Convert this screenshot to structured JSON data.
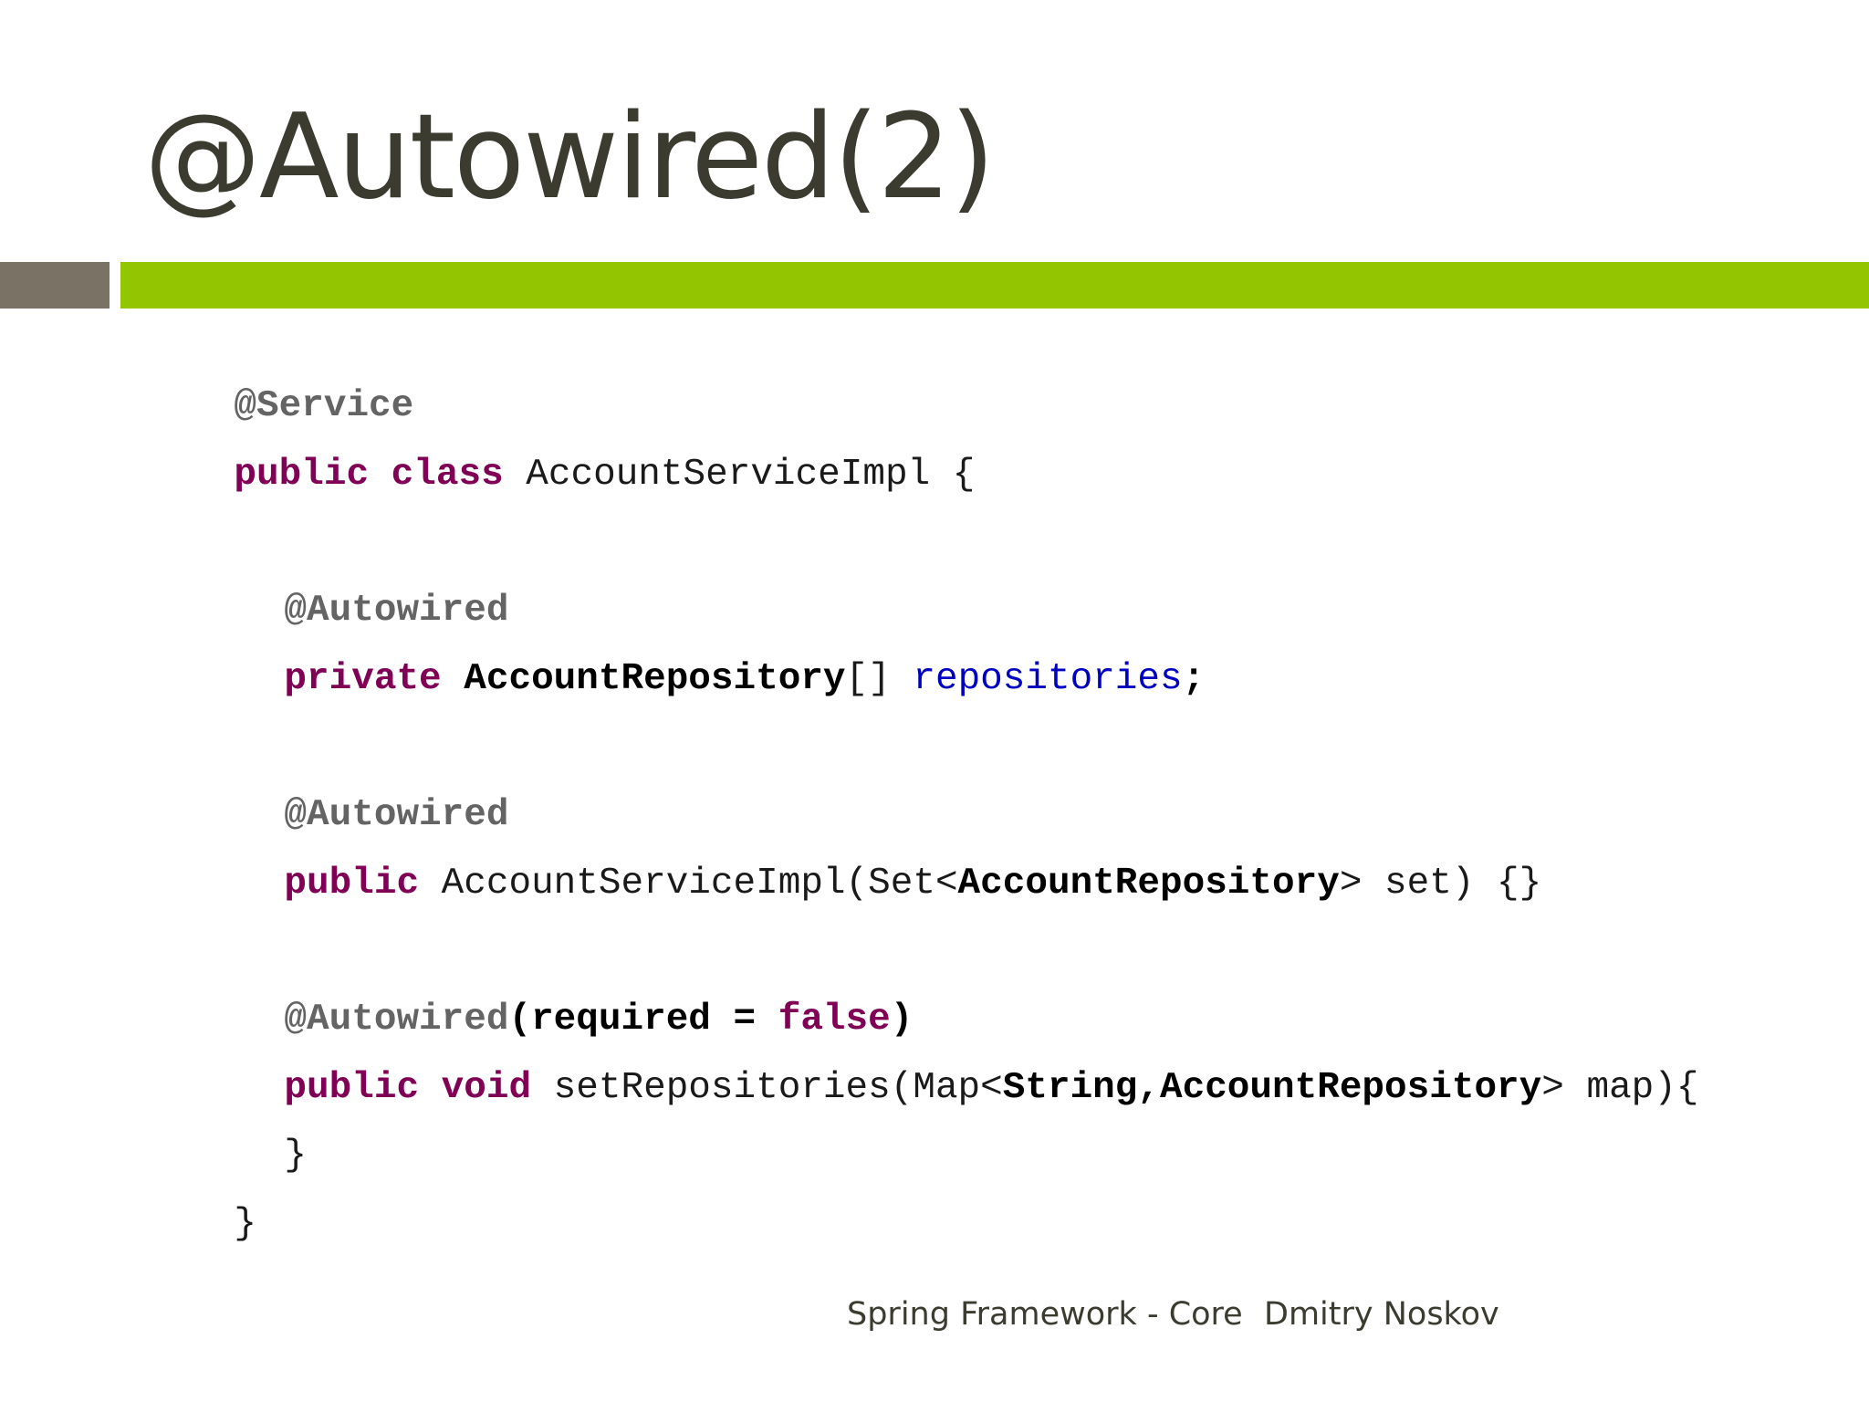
{
  "slide": {
    "title": "@Autowired(2)"
  },
  "code": {
    "line1": {
      "annotation": "@Service"
    },
    "line2": {
      "kw": "public class",
      "rest": " AccountServiceImpl {"
    },
    "line3": {
      "annotation": "@Autowired"
    },
    "line4": {
      "kw": "private",
      "sp": " ",
      "type": "AccountRepository",
      "brackets": "[] ",
      "field": "repositories",
      "semi": ";"
    },
    "line5": {
      "annotation": "@Autowired"
    },
    "line6": {
      "kw": "public",
      "pre": " AccountServiceImpl(Set<",
      "type": "AccountRepository",
      "post": "> set) {}"
    },
    "line7": {
      "annotation": "@Autowired",
      "open": "(required = ",
      "kw": "false",
      "close": ")"
    },
    "line8": {
      "kw": "public void",
      "pre": " setRepositories(Map<",
      "type": "String,AccountRepository",
      "post": "> map){"
    },
    "line9": {
      "text": "}"
    },
    "line10": {
      "text": "}"
    }
  },
  "footer": {
    "course": "Spring Framework - Core",
    "author": "Dmitry Noskov"
  },
  "colors": {
    "accent_green": "#94c600",
    "accent_gray": "#7a7264",
    "keyword": "#7f0055",
    "annotation": "#646464",
    "field": "#0000c0",
    "title": "#3b3b30"
  }
}
